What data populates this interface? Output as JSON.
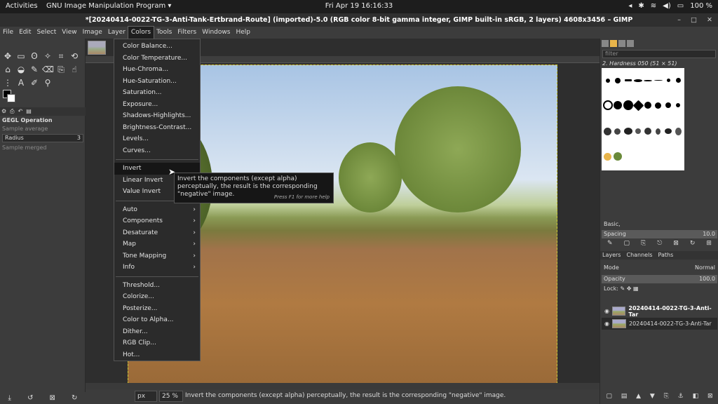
{
  "topbar": {
    "activities": "Activities",
    "app": "GNU Image Manipulation Program ▾",
    "clock": "Fri Apr 19  16:16:33",
    "battery": "100 %",
    "tray_icons": [
      "notification-icon",
      "accessibility-icon",
      "wifi-icon",
      "volume-icon",
      "battery-icon"
    ]
  },
  "window": {
    "title": "*[20240414-0022-TG-3-Anti-Tank-Ertbrand-Route] (imported)-5.0 (RGB color 8-bit gamma integer, GIMP built-in sRGB, 2 layers) 4608x3456 – GIMP",
    "minimize": "–",
    "maximize": "□",
    "close": "✕"
  },
  "menubar": {
    "items": [
      "File",
      "Edit",
      "Select",
      "View",
      "Image",
      "Layer",
      "Colors",
      "Tools",
      "Filters",
      "Windows",
      "Help"
    ],
    "active": "Colors"
  },
  "colors_menu": {
    "group1": [
      "Color Balance...",
      "Color Temperature...",
      "Hue-Chroma...",
      "Hue-Saturation...",
      "Saturation...",
      "Exposure...",
      "Shadows-Highlights...",
      "Brightness-Contrast...",
      "Levels...",
      "Curves..."
    ],
    "group2": [
      "Invert",
      "Linear Invert",
      "Value Invert"
    ],
    "group3": [
      "Auto",
      "Components",
      "Desaturate",
      "Map",
      "Tone Mapping",
      "Info"
    ],
    "group4": [
      "Threshold...",
      "Colorize...",
      "Posterize...",
      "Color to Alpha...",
      "Dither...",
      "RGB Clip...",
      "Hot..."
    ],
    "highlighted": "Invert"
  },
  "tooltip": {
    "text": "Invert the components (except alpha) perceptually, the result is the corresponding \"negative\" image.",
    "hint": "Press F1 for more help"
  },
  "tool_options": {
    "title": "GEGL Operation",
    "sample_average": "Sample average",
    "radius_label": "Radius",
    "radius_value": "3",
    "sample_merged": "Sample merged"
  },
  "statusbar": {
    "unit": "px",
    "zoom": "25 %",
    "message": "Invert the components (except alpha) perceptually, the result is the corresponding \"negative\" image."
  },
  "brushes": {
    "filter_placeholder": "filter",
    "current": "2. Hardness 050 (51 × 51)",
    "preset": "Basic,",
    "spacing_label": "Spacing",
    "spacing_value": "10.0"
  },
  "layers_panel": {
    "tabs": [
      "Layers",
      "Channels",
      "Paths"
    ],
    "mode_label": "Mode",
    "mode_value": "Normal",
    "opacity_label": "Opacity",
    "opacity_value": "100.0",
    "lock_label": "Lock:",
    "layers": [
      {
        "name": "20240414-0022-TG-3-Anti-Tar"
      },
      {
        "name": "20240414-0022-TG-3-Anti-Tar"
      }
    ]
  }
}
